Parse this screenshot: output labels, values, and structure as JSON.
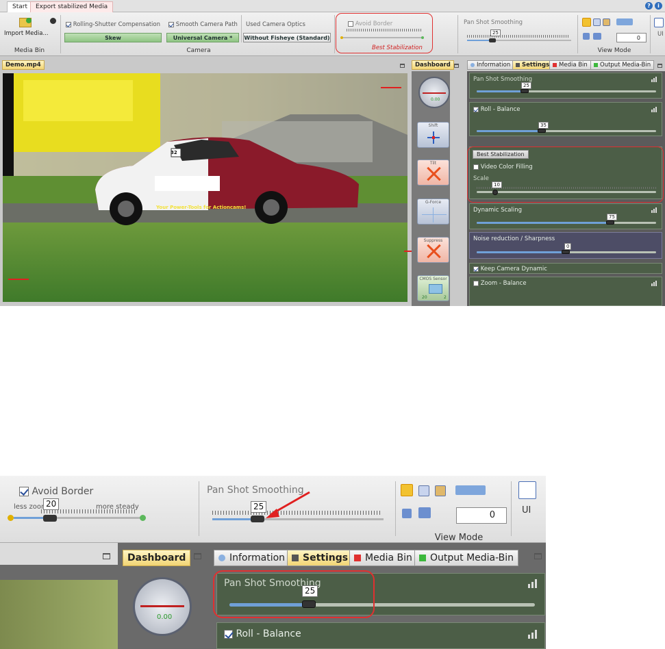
{
  "tabs": [
    {
      "label": "Start"
    },
    {
      "label": "Export stabilized Media"
    }
  ],
  "help_icon": "question-icon",
  "info_icon": "info-icon",
  "ribbon": {
    "import_label": "Import Media...",
    "media_bin_group": "Media Bin",
    "rolling_shutter_label": "Rolling-Shutter Compensation",
    "rolling_shutter_value": "Skew",
    "smooth_path_label": "Smooth Camera Path",
    "smooth_path_value": "Universal Camera *",
    "optics_label": "Used Camera Optics",
    "optics_value": "Without Fisheye (Standard)",
    "camera_group": "Camera",
    "avoid_border_label": "Avoid Border",
    "best_stabilization_label": "Best Stabilization",
    "pan_label": "Pan Shot Smoothing",
    "pan_value": "25",
    "view_mode_group": "View Mode",
    "view_mode_value": "0",
    "ui_label": "UI"
  },
  "video_panel": {
    "title": "Demo.mp4",
    "car_number": "32",
    "car_slogan": "Your Power-Tools for Actioncams!"
  },
  "dashboard": {
    "title": "Dashboard",
    "gauge_value": "0.00",
    "items": [
      {
        "label": "Shift"
      },
      {
        "label": "Tilt"
      },
      {
        "label": "G-Force"
      },
      {
        "label": "Suppress"
      },
      {
        "label": "CMOS Sensor"
      }
    ],
    "cmos_values": [
      "20",
      "2"
    ]
  },
  "settings_tabs": [
    {
      "label": "Information"
    },
    {
      "label": "Settings"
    },
    {
      "label": "Media Bin"
    },
    {
      "label": "Output Media-Bin"
    }
  ],
  "tab_colors": {
    "media_bin": "#e03030",
    "output_media_bin": "#3cb83c"
  },
  "settings": {
    "pan": {
      "label": "Pan Shot Smoothing",
      "value": "25"
    },
    "roll": {
      "label": "Roll - Balance",
      "value": "35"
    },
    "best": {
      "button": "Best Stabilization",
      "video_fill": "Video Color Filling",
      "scale_label": "Scale",
      "scale_value": "10"
    },
    "dynamic": {
      "label": "Dynamic Scaling",
      "value": "75"
    },
    "noise": {
      "label": "Noise reduction / Sharpness",
      "value": "0"
    },
    "keep_dynamic": "Keep Camera Dynamic",
    "zoom_balance": "Zoom - Balance"
  },
  "zoom": {
    "avoid_border_label": "Avoid Border",
    "less_zoom": "less zoom",
    "more_steady": "more steady",
    "avoid_value": "20",
    "pan_label": "Pan Shot Smoothing",
    "pan_value": "25",
    "view_mode_group": "View Mode",
    "view_mode_value": "0",
    "ui_label": "UI",
    "dashboard_title": "Dashboard",
    "gauge_value": "0.00",
    "tabs": [
      {
        "label": "Information"
      },
      {
        "label": "Settings"
      },
      {
        "label": "Media Bin"
      },
      {
        "label": "Output Media-Bin"
      }
    ],
    "settings_pan_label": "Pan Shot Smoothing",
    "settings_pan_value": "25",
    "roll_label": "Roll - Balance"
  }
}
